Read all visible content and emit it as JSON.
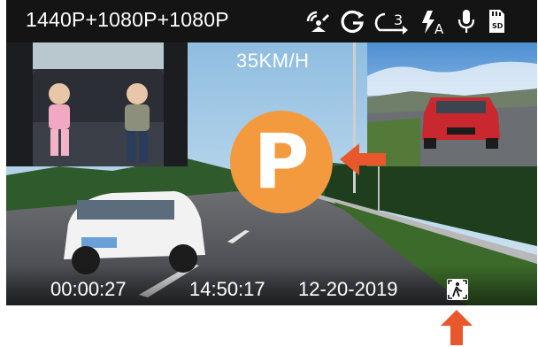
{
  "topbar": {
    "resolution": "1440P+1080P+1080P",
    "icons": [
      "gps-satellite-icon",
      "g-sensor-icon",
      "loop-recording-3min-icon",
      "auto-flash-icon",
      "microphone-icon",
      "sd-card-icon"
    ],
    "loop_minutes": "3",
    "flash_mode": "A",
    "sd_label": "SD"
  },
  "overlay": {
    "speed": "35KM/H",
    "parking_letter": "P",
    "accent_color": "#f39a3f"
  },
  "bottombar": {
    "elapsed": "00:00:27",
    "time": "14:50:17",
    "date": "12-20-2019",
    "icon": "pedestrian-detect-icon"
  },
  "colors": {
    "arrow": "#e8582c"
  }
}
